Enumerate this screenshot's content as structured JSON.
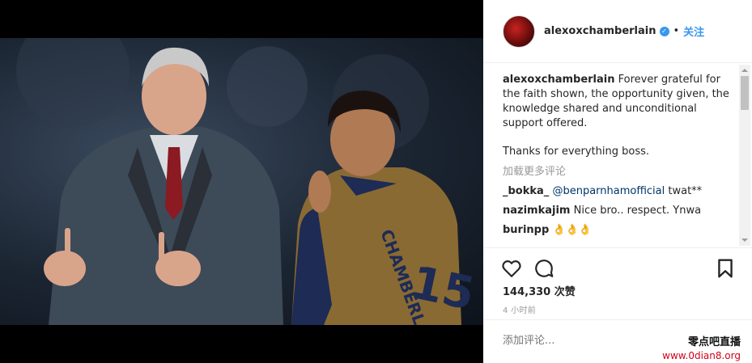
{
  "post": {
    "username": "alexoxchamberlain",
    "follow_label": "关注",
    "dot": "•",
    "caption": {
      "username": "alexoxchamberlain",
      "text": "Forever grateful for the faith shown, the opportunity given, the knowledge shared and unconditional support offered.",
      "text2": "Thanks for everything boss."
    },
    "load_more": "加载更多评论",
    "comments": [
      {
        "username": "_bokka_",
        "mention": "@benparnhamofficial",
        "text": " twat**"
      },
      {
        "username": "nazimkajim",
        "text": "Nice bro.. respect. Ynwa"
      },
      {
        "username": "burinpp",
        "text": "👌👌👌"
      }
    ],
    "likes": "144,330 次赞",
    "time_ago": "4 小时前",
    "add_comment_placeholder": "添加评论..."
  },
  "photo": {
    "jersey_number": "15",
    "jersey_name": "CHAMBERLAIN"
  },
  "watermark": {
    "line1": "零点吧直播",
    "line2": "www.0dian8.org"
  },
  "colors": {
    "accent": "#3897f0",
    "watermark_red": "#d0021b"
  }
}
